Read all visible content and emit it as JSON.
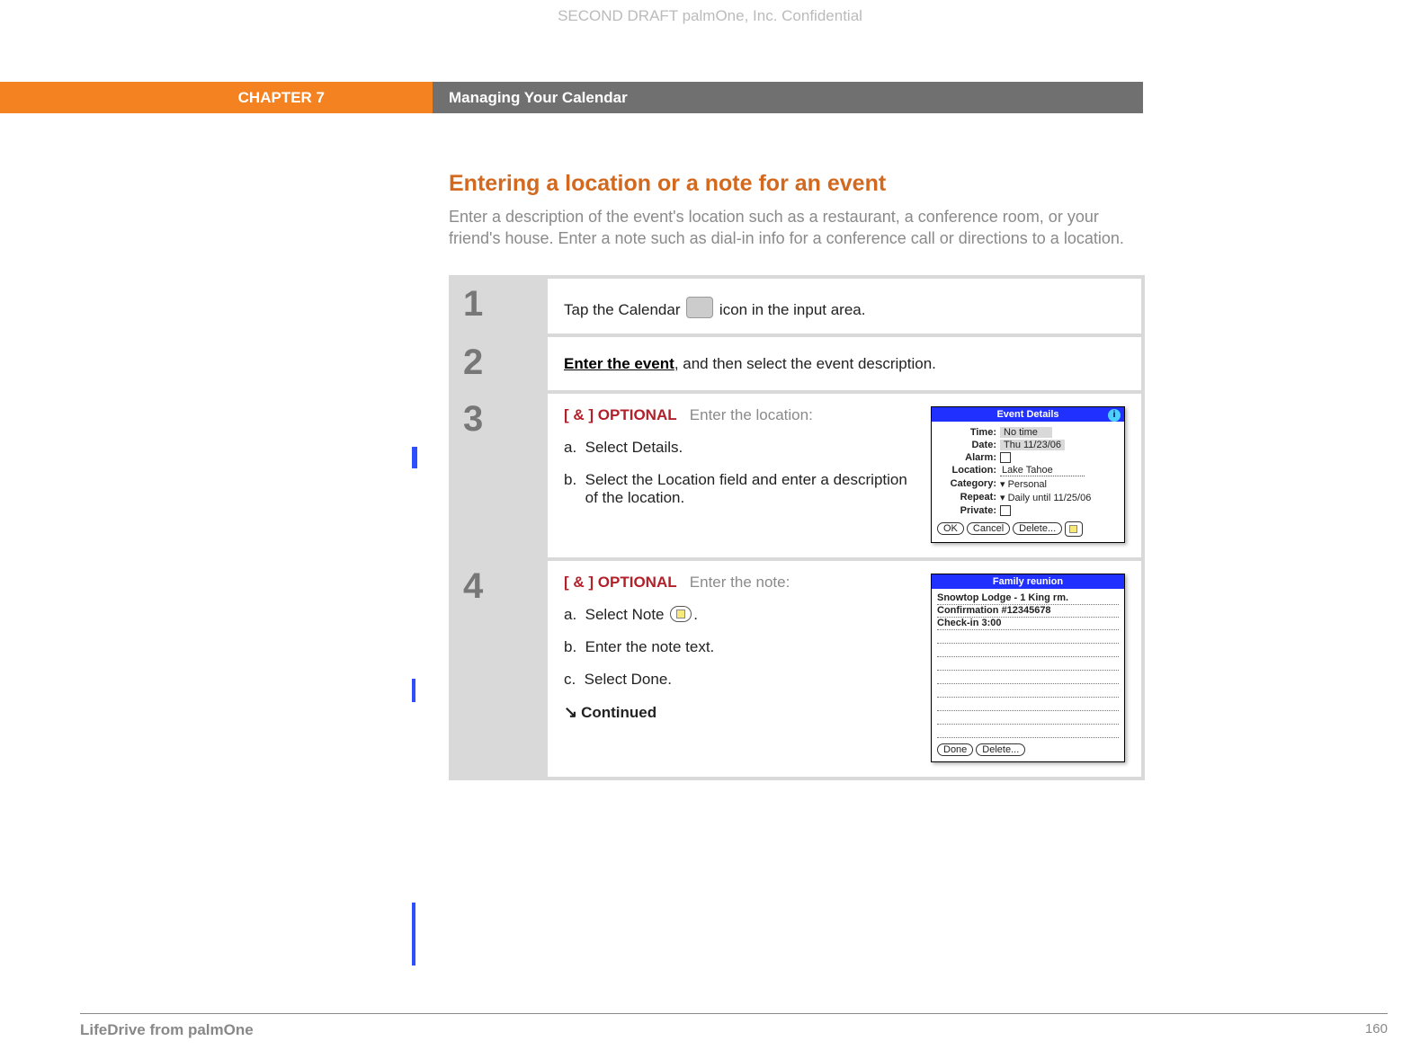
{
  "watermark": "SECOND DRAFT palmOne, Inc.  Confidential",
  "chapter": {
    "label": "CHAPTER 7",
    "title": "Managing Your Calendar"
  },
  "section": {
    "title": "Entering a location or a note for an event",
    "intro": "Enter a description of the event's location such as a restaurant, a conference room, or your friend's house. Enter a note such as dial-in info for a conference call or directions to a location."
  },
  "steps": [
    {
      "num": "1",
      "pre": "Tap the Calendar ",
      "post": " icon in the input area."
    },
    {
      "num": "2",
      "link": "Enter the event",
      "post": ", and then select the event description."
    },
    {
      "num": "3",
      "optional": "[ & ]  OPTIONAL",
      "lead": "Enter the location:",
      "a": "Select Details.",
      "b": "Select the Location field and enter a description of the location."
    },
    {
      "num": "4",
      "optional": "[ & ]  OPTIONAL",
      "lead": "Enter the note:",
      "a_pre": "Select Note ",
      "a_post": ".",
      "b": "Enter the note text.",
      "c": "Select Done.",
      "continued": "Continued"
    }
  ],
  "palm_details": {
    "title": "Event Details",
    "time_label": "Time:",
    "time_val": "No time",
    "date_label": "Date:",
    "date_val": "Thu 11/23/06",
    "alarm_label": "Alarm:",
    "location_label": "Location:",
    "location_val": "Lake Tahoe",
    "category_label": "Category:",
    "category_val": "Personal",
    "repeat_label": "Repeat:",
    "repeat_val": "Daily until 11/25/06",
    "private_label": "Private:",
    "ok": "OK",
    "cancel": "Cancel",
    "delete": "Delete..."
  },
  "palm_note": {
    "title": "Family reunion",
    "line1": "Snowtop Lodge - 1 King rm.",
    "line2": "Confirmation #12345678",
    "line3": "Check-in 3:00",
    "done": "Done",
    "delete": "Delete..."
  },
  "footer": {
    "product": "LifeDrive from palmOne",
    "page": "160"
  }
}
